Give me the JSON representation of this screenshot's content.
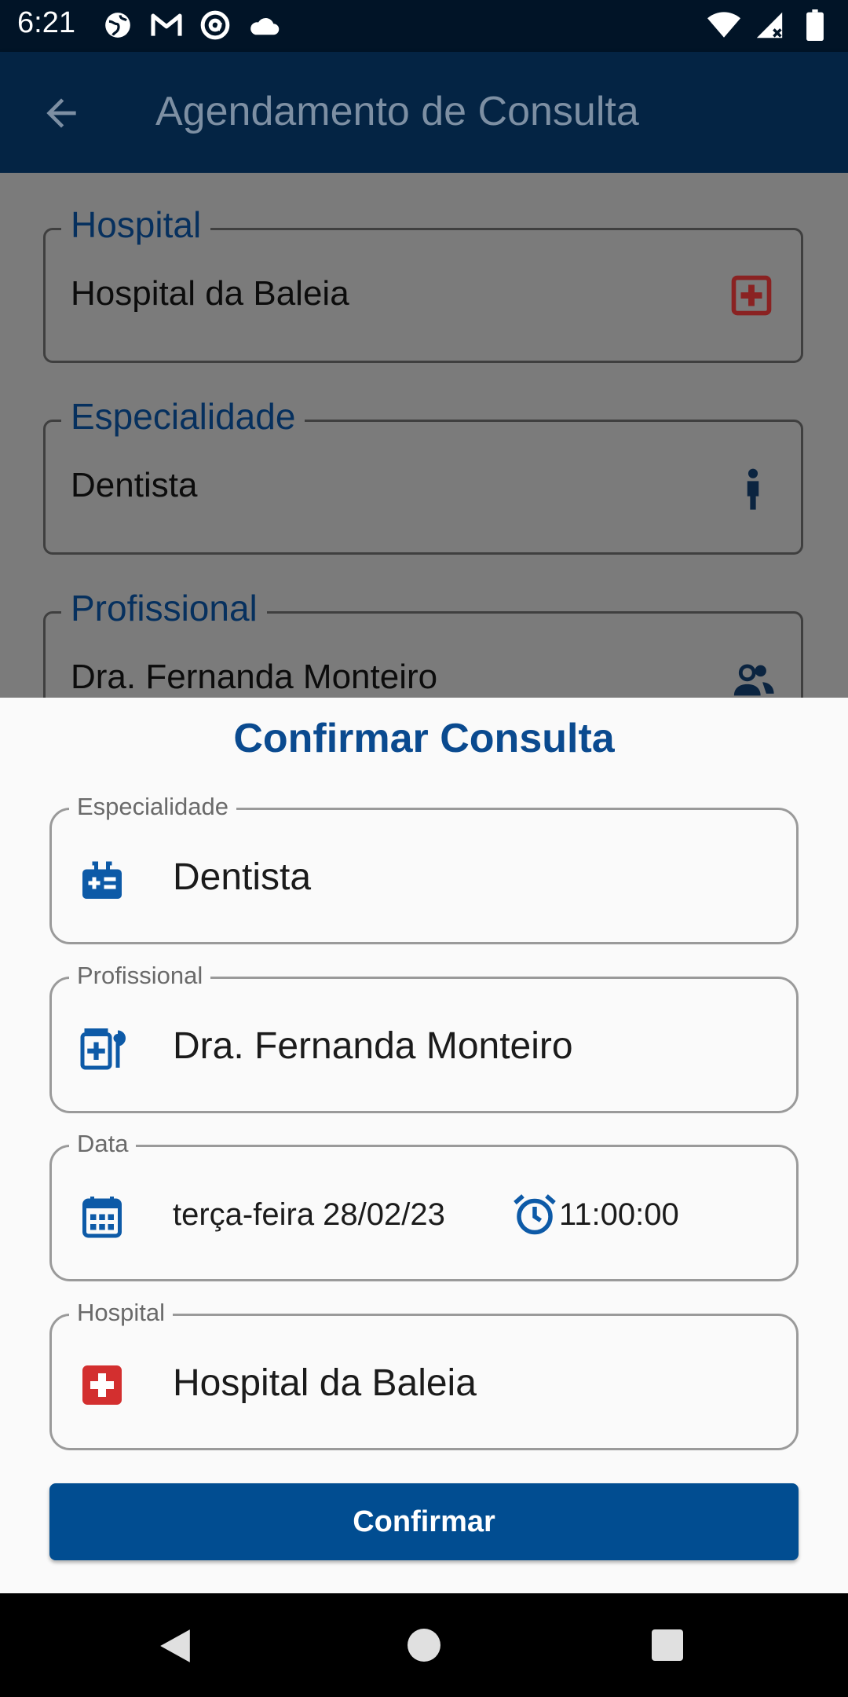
{
  "status_bar": {
    "time": "6:21",
    "left_icons": [
      "globe-icon",
      "gmail-icon",
      "at-sign-icon",
      "cloud-icon"
    ],
    "right_icons": [
      "wifi-icon",
      "cell-signal-icon",
      "battery-icon"
    ]
  },
  "app_bar": {
    "title": "Agendamento de Consulta",
    "back_icon": "arrow-back-icon"
  },
  "background_form": {
    "fields": [
      {
        "label": "Hospital",
        "value": "Hospital da Baleia",
        "icon": "hospital-plus-icon"
      },
      {
        "label": "Especialidade",
        "value": "Dentista",
        "icon": "person-icon"
      },
      {
        "label": "Profissional",
        "value": "Dra. Fernanda Monteiro",
        "icon": "people-icon"
      }
    ]
  },
  "sheet": {
    "title": "Confirmar Consulta",
    "especialidade": {
      "label": "Especialidade",
      "value": "Dentista",
      "icon": "medical-bag-icon"
    },
    "profissional": {
      "label": "Profissional",
      "value": "Dra. Fernanda Monteiro",
      "icon": "medical-kit-icon"
    },
    "data": {
      "label": "Data",
      "date": "terça-feira 28/02/23",
      "time": "11:00:00",
      "icon": "calendar-icon",
      "time_icon": "alarm-clock-icon"
    },
    "hospital": {
      "label": "Hospital",
      "value": "Hospital da Baleia",
      "icon": "hospital-cross-icon"
    },
    "confirm_label": "Confirmar"
  },
  "colors": {
    "accent": "#014d91",
    "app_bar": "#042444",
    "hospital_red": "#d32f2f"
  }
}
